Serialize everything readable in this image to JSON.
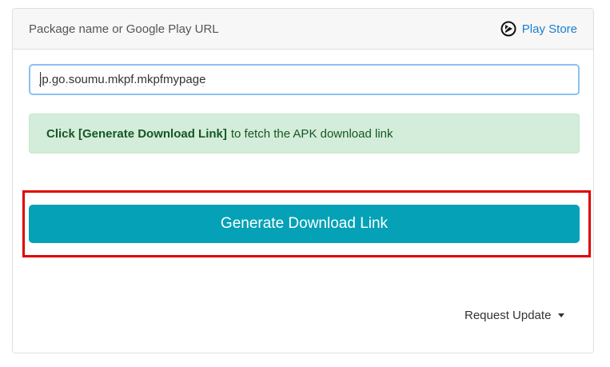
{
  "header": {
    "label": "Package name or Google Play URL",
    "store_link_label": "Play Store",
    "store_icon": "play-store-icon"
  },
  "search": {
    "value": "jp.go.soumu.mkpf.mkpfmypage"
  },
  "alert": {
    "bold_text": "Click [Generate Download Link]",
    "text": "to fetch the APK download link"
  },
  "actions": {
    "generate_label": "Generate Download Link",
    "request_update_label": "Request Update"
  },
  "colors": {
    "button": "#04a1b7",
    "highlight": "#e00000",
    "alert_bg": "#d4edda",
    "link": "#1b7fd1"
  }
}
